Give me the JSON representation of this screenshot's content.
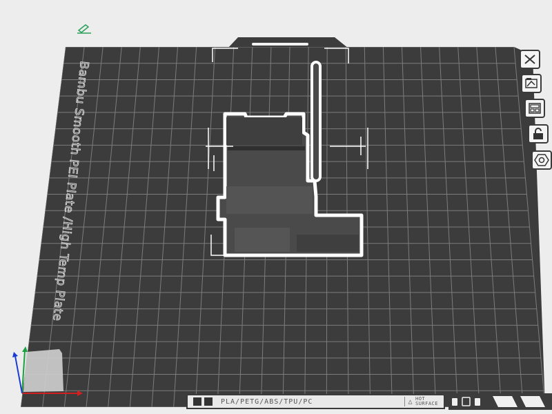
{
  "plate": {
    "label": "Bambu Smooth PEI Plate /High Temp Plate",
    "color": "#3c3c3c",
    "grid_color": "#7d7d7d",
    "outline_color": "#ffffff"
  },
  "toolbar": {
    "close_icon": "close-icon",
    "arrange_icon": "arrange-icon",
    "orient_icon": "orient-icon",
    "lock_icon": "unlock-icon",
    "settings_icon": "settings-icon"
  },
  "filament_strip": {
    "types": "PLA/PETG/ABS/TPU/PC",
    "hot_surface_line1": "HOT",
    "hot_surface_line2": "SURFACE"
  },
  "scene": {
    "edit_icon": "edit-icon",
    "axes": "axes-gizmo"
  }
}
